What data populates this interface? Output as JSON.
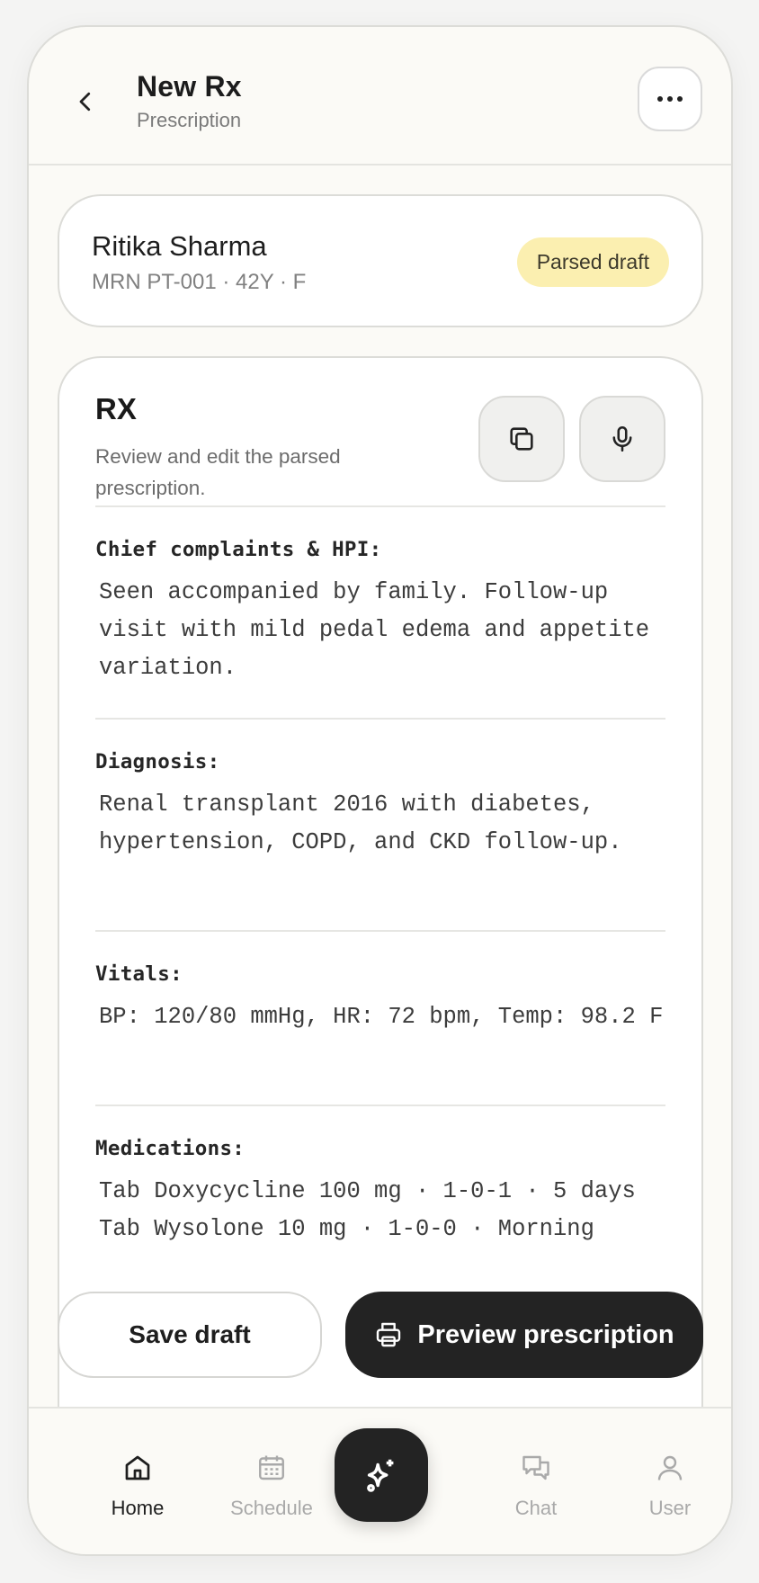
{
  "header": {
    "title": "New Rx",
    "subtitle": "Prescription",
    "back_icon": "chevron-left-icon",
    "more_icon": "more-horizontal-icon"
  },
  "patient": {
    "name": "Ritika Sharma",
    "meta": "MRN PT-001 · 42Y · F",
    "status_badge": "Parsed draft"
  },
  "rx": {
    "title": "RX",
    "description": "Review and edit the parsed prescription.",
    "copy_icon": "copy-icon",
    "mic_icon": "microphone-icon",
    "sections": [
      {
        "label": "Chief complaints & HPI:",
        "text": "Seen accompanied by family. Follow-up visit with mild pedal edema and appetite variation."
      },
      {
        "label": "Diagnosis:",
        "text": "Renal transplant 2016 with diabetes, hypertension, COPD, and CKD follow-up."
      },
      {
        "label": "Vitals:",
        "text": "BP: 120/80 mmHg, HR: 72 bpm, Temp: 98.2 F"
      },
      {
        "label": "Medications:",
        "text": "Tab Doxycycline 100 mg · 1-0-1 · 5 days\nTab Wysolone 10 mg · 1-0-0 · Morning"
      }
    ]
  },
  "actions": {
    "save_label": "Save draft",
    "preview_label": "Preview prescription",
    "preview_icon": "printer-icon"
  },
  "nav": {
    "items": [
      {
        "label": "Home",
        "icon": "home-icon"
      },
      {
        "label": "Schedule",
        "icon": "calendar-icon"
      },
      {
        "label": "Chat",
        "icon": "chat-icon"
      },
      {
        "label": "User",
        "icon": "user-icon"
      }
    ],
    "fab_icon": "sparkles-icon"
  },
  "colors": {
    "accent_dark": "#232323",
    "badge_bg": "#fbefb0",
    "background": "#fbfaf6"
  }
}
